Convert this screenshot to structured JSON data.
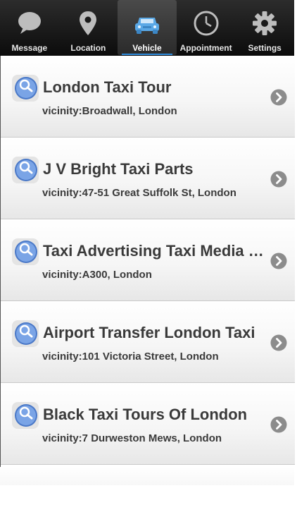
{
  "tabbar": {
    "tabs": [
      {
        "label": "Message",
        "icon": "speech-bubble-icon",
        "active": false
      },
      {
        "label": "Location",
        "icon": "location-pin-icon",
        "active": false
      },
      {
        "label": "Vehicle",
        "icon": "car-icon",
        "active": true
      },
      {
        "label": "Appointment",
        "icon": "clock-icon",
        "active": false
      },
      {
        "label": "Settings",
        "icon": "gear-icon",
        "active": false
      }
    ]
  },
  "list": {
    "items": [
      {
        "title": "London Taxi Tour",
        "vicinity": "vicinity:Broadwall, London"
      },
      {
        "title": "J V Bright Taxi Parts",
        "vicinity": "vicinity:47-51 Great Suffolk St, London"
      },
      {
        "title": "Taxi Advertising Taxi Media L...",
        "vicinity": "vicinity:A300, London"
      },
      {
        "title": "Airport Transfer London Taxi",
        "vicinity": "vicinity:101 Victoria Street, London"
      },
      {
        "title": "Black Taxi Tours Of London",
        "vicinity": "vicinity:7 Durweston Mews, London"
      }
    ]
  },
  "colors": {
    "tabbar_bg": "#1a1a1a",
    "active_underline": "#2f8ee0",
    "text": "#3a3a3a",
    "chevron": "#8c8c8c"
  }
}
